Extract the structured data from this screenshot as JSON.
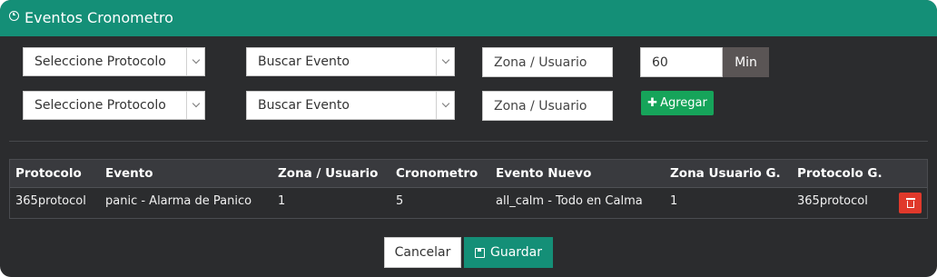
{
  "header": {
    "title": "Eventos Cronometro",
    "icon": "clock-icon"
  },
  "form": {
    "row1": {
      "protocol_select": "Seleccione Protocolo",
      "event_select": "Buscar Evento",
      "zone_placeholder": "Zona / Usuario",
      "minutes_value": "60",
      "minutes_addon": "Min"
    },
    "row2": {
      "protocol_select": "Seleccione Protocolo",
      "event_select": "Buscar Evento",
      "zone_placeholder": "Zona / Usuario",
      "add_button": "Agregar"
    }
  },
  "table": {
    "headers": [
      "Protocolo",
      "Evento",
      "Zona / Usuario",
      "Cronometro",
      "Evento Nuevo",
      "Zona Usuario G.",
      "Protocolo G."
    ],
    "rows": [
      [
        "365protocol",
        "panic - Alarma de Panico",
        "1",
        "5",
        "all_calm - Todo en Calma",
        "1",
        "365protocol"
      ]
    ]
  },
  "footer": {
    "cancel_label": "Cancelar",
    "save_label": "Guardar"
  },
  "colors": {
    "header": "#148f77",
    "add_button": "#16a45a",
    "delete_button": "#e0392b",
    "panel": "#2b2c2e"
  }
}
